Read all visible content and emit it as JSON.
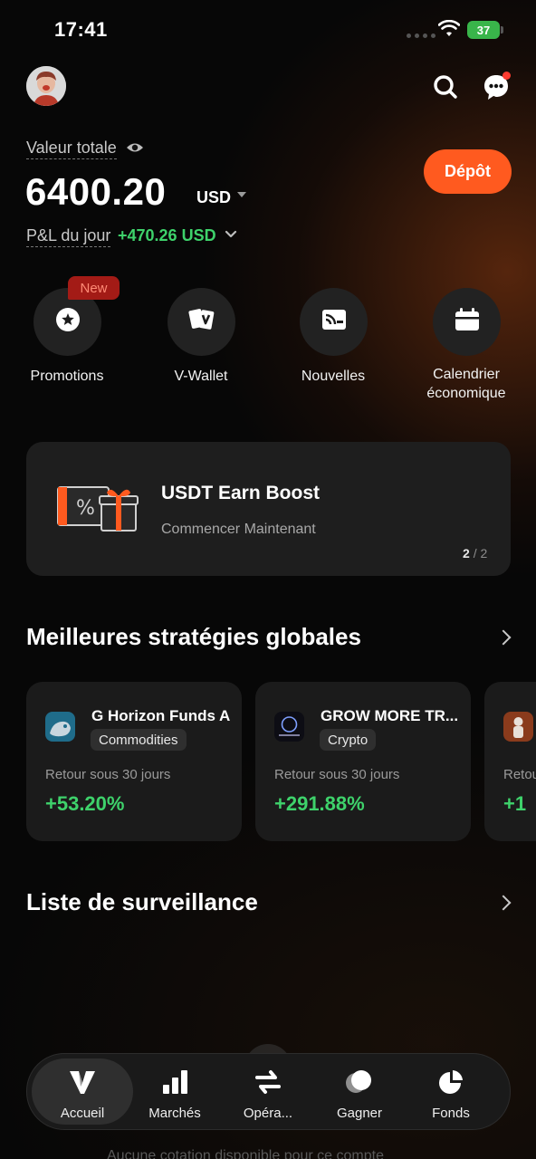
{
  "status_bar": {
    "time": "17:41",
    "battery": "37"
  },
  "header": {
    "total_label": "Valeur totale",
    "total_value": "6400.20",
    "currency": "USD",
    "pnl_label": "P&L du jour",
    "pnl_value": "+470.26 USD",
    "deposit_label": "Dépôt"
  },
  "quick_actions": [
    {
      "label": "Promotions",
      "icon": "star-badge-icon",
      "badge": "New"
    },
    {
      "label": "V-Wallet",
      "icon": "cards-icon"
    },
    {
      "label": "Nouvelles",
      "icon": "news-icon"
    },
    {
      "label": "Calendrier économique",
      "icon": "calendar-icon"
    }
  ],
  "banner": {
    "title": "USDT Earn Boost",
    "subtitle": "Commencer Maintenant",
    "page_current": "2",
    "page_total": "/ 2"
  },
  "strategies": {
    "title": "Meilleures stratégies globales",
    "cards": [
      {
        "name": "G Horizon Funds A",
        "tag": "Commodities",
        "return_label": "Retour sous 30 jours",
        "return_value": "+53.20%"
      },
      {
        "name": "GROW MORE TR...",
        "tag": "Crypto",
        "return_label": "Retour sous 30 jours",
        "return_value": "+291.88%"
      },
      {
        "name": "",
        "tag": "",
        "return_label": "Retou",
        "return_value": "+1"
      }
    ]
  },
  "watchlist": {
    "title": "Liste de surveillance",
    "empty_text": "Aucune cotation disponible pour ce compte"
  },
  "bottom_nav": [
    {
      "label": "Accueil",
      "icon": "v-logo-icon",
      "active": true
    },
    {
      "label": "Marchés",
      "icon": "bar-chart-icon"
    },
    {
      "label": "Opéra...",
      "icon": "swap-icon"
    },
    {
      "label": "Gagner",
      "icon": "coins-icon"
    },
    {
      "label": "Fonds",
      "icon": "pie-chart-icon"
    }
  ],
  "colors": {
    "accent": "#ff5a1f",
    "positive": "#3ed26b",
    "background": "#070707"
  }
}
